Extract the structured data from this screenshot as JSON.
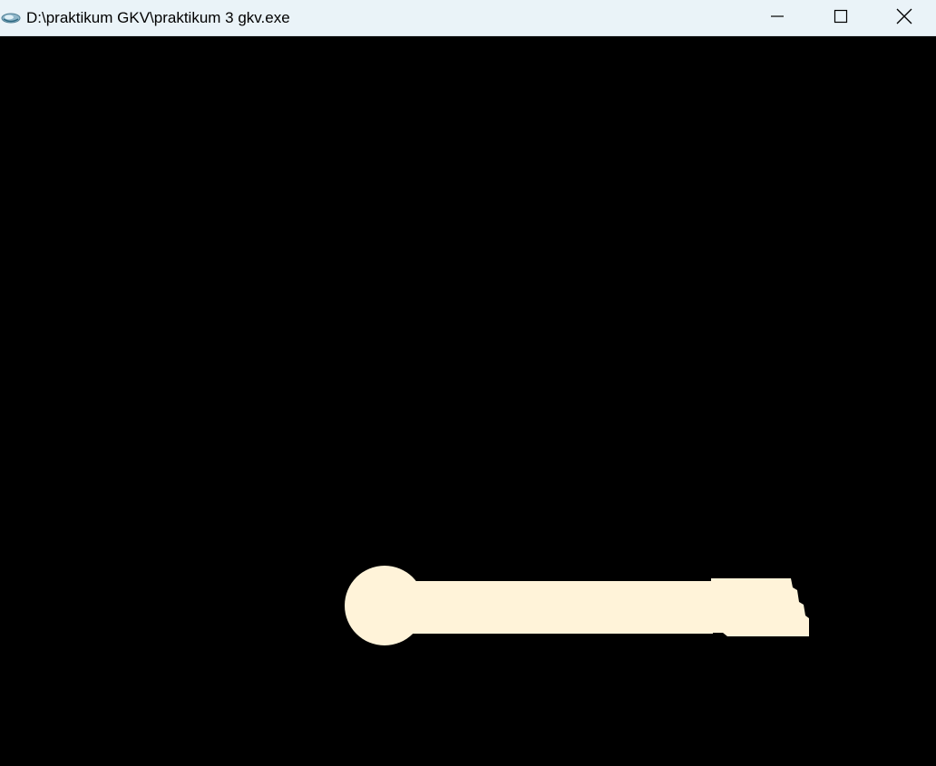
{
  "window": {
    "title": "D:\\praktikum GKV\\praktikum 3 gkv.exe",
    "titlebar_color": "#eaf3f8",
    "canvas_background": "#000000"
  },
  "icons": {
    "app": "opengl-app-icon",
    "minimize": "minimize-icon",
    "maximize": "maximize-icon",
    "close": "close-icon"
  },
  "scene": {
    "shape_color": "#fff3d9"
  }
}
